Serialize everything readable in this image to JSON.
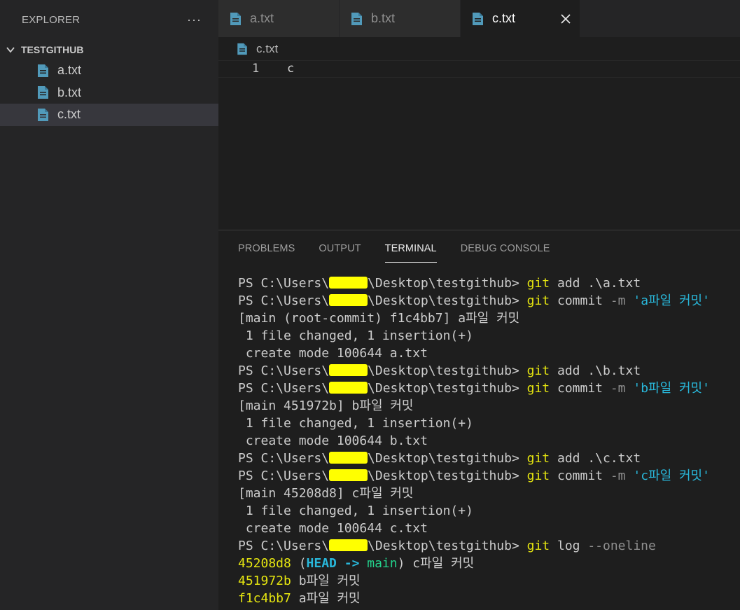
{
  "sidebar": {
    "title": "EXPLORER",
    "more_label": "···",
    "folder": "TESTGITHUB",
    "files": [
      "a.txt",
      "b.txt",
      "c.txt"
    ],
    "selected_file": "c.txt"
  },
  "tabs": [
    {
      "label": "a.txt",
      "active": false
    },
    {
      "label": "b.txt",
      "active": false
    },
    {
      "label": "c.txt",
      "active": true
    }
  ],
  "breadcrumb": "c.txt",
  "editor": {
    "line_number": "1",
    "content": "c"
  },
  "panel": {
    "tabs": [
      "PROBLEMS",
      "OUTPUT",
      "TERMINAL",
      "DEBUG CONSOLE"
    ],
    "active_tab": "TERMINAL"
  },
  "terminal": {
    "lines": [
      [
        {
          "t": "PS C:\\Users\\"
        },
        {
          "redact": true
        },
        {
          "t": "\\Desktop\\testgithub> "
        },
        {
          "t": "git",
          "c": "yellow"
        },
        {
          "t": " add .\\a.txt"
        }
      ],
      [
        {
          "t": "PS C:\\Users\\"
        },
        {
          "redact": true
        },
        {
          "t": "\\Desktop\\testgithub> "
        },
        {
          "t": "git",
          "c": "yellow"
        },
        {
          "t": " commit "
        },
        {
          "t": "-m",
          "c": "gray"
        },
        {
          "t": " 'a파일 커밋'",
          "c": "cyan"
        }
      ],
      [
        {
          "t": "[main (root-commit) f1c4bb7] a파일 커밋"
        }
      ],
      [
        {
          "t": " 1 file changed, 1 insertion(+)"
        }
      ],
      [
        {
          "t": " create mode 100644 a.txt"
        }
      ],
      [
        {
          "t": "PS C:\\Users\\"
        },
        {
          "redact": true
        },
        {
          "t": "\\Desktop\\testgithub> "
        },
        {
          "t": "git",
          "c": "yellow"
        },
        {
          "t": " add .\\b.txt"
        }
      ],
      [
        {
          "t": "PS C:\\Users\\"
        },
        {
          "redact": true
        },
        {
          "t": "\\Desktop\\testgithub> "
        },
        {
          "t": "git",
          "c": "yellow"
        },
        {
          "t": " commit "
        },
        {
          "t": "-m",
          "c": "gray"
        },
        {
          "t": " 'b파일 커밋'",
          "c": "cyan"
        }
      ],
      [
        {
          "t": "[main 451972b] b파일 커밋"
        }
      ],
      [
        {
          "t": " 1 file changed, 1 insertion(+)"
        }
      ],
      [
        {
          "t": " create mode 100644 b.txt"
        }
      ],
      [
        {
          "t": "PS C:\\Users\\"
        },
        {
          "redact": true
        },
        {
          "t": "\\Desktop\\testgithub> "
        },
        {
          "t": "git",
          "c": "yellow"
        },
        {
          "t": " add .\\c.txt"
        }
      ],
      [
        {
          "t": "PS C:\\Users\\"
        },
        {
          "redact": true
        },
        {
          "t": "\\Desktop\\testgithub> "
        },
        {
          "t": "git",
          "c": "yellow"
        },
        {
          "t": " commit "
        },
        {
          "t": "-m",
          "c": "gray"
        },
        {
          "t": " 'c파일 커밋'",
          "c": "cyan"
        }
      ],
      [
        {
          "t": "[main 45208d8] c파일 커밋"
        }
      ],
      [
        {
          "t": " 1 file changed, 1 insertion(+)"
        }
      ],
      [
        {
          "t": " create mode 100644 c.txt"
        }
      ],
      [
        {
          "t": "PS C:\\Users\\"
        },
        {
          "redact": true
        },
        {
          "t": "\\Desktop\\testgithub> "
        },
        {
          "t": "git",
          "c": "yellow"
        },
        {
          "t": " log "
        },
        {
          "t": "--oneline",
          "c": "gray"
        }
      ],
      [
        {
          "t": "45208d8",
          "c": "yellow"
        },
        {
          "t": " ("
        },
        {
          "t": "HEAD -> ",
          "c": "head"
        },
        {
          "t": "main",
          "c": "green"
        },
        {
          "t": ")"
        },
        {
          "t": " c파일 커밋"
        }
      ],
      [
        {
          "t": "451972b",
          "c": "yellow"
        },
        {
          "t": " b파일 커밋"
        }
      ],
      [
        {
          "t": "f1c4bb7",
          "c": "yellow"
        },
        {
          "t": " a파일 커밋"
        }
      ]
    ]
  },
  "colors": {
    "file_icon": "#519aba",
    "git_yellow": "#e5e510",
    "string_cyan": "#29b8db",
    "branch_green": "#23d18b",
    "redaction": "#ffff00"
  }
}
